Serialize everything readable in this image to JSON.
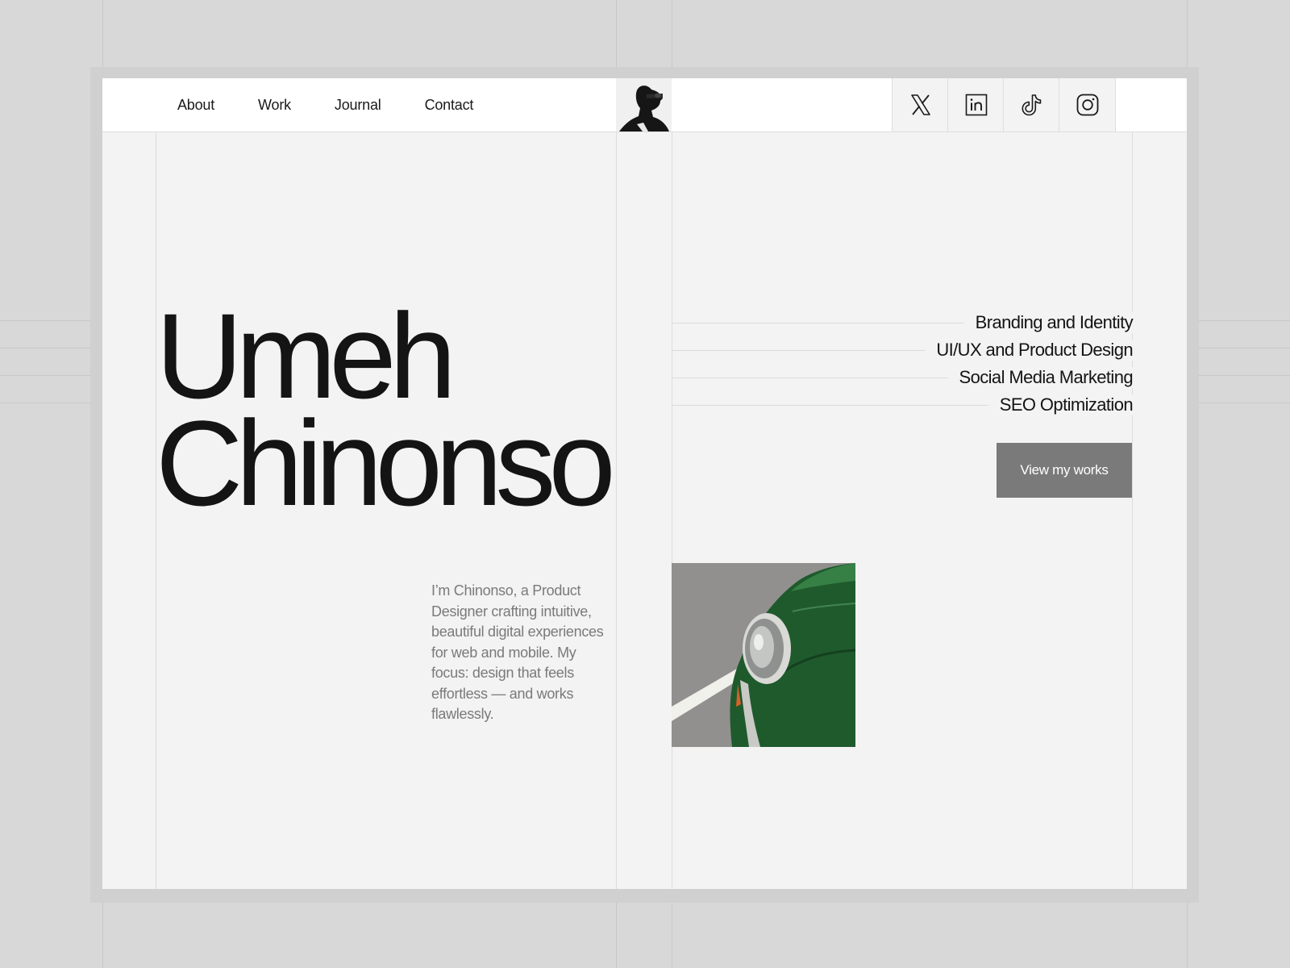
{
  "nav": {
    "items": [
      {
        "label": "About"
      },
      {
        "label": "Work"
      },
      {
        "label": "Journal"
      },
      {
        "label": "Contact"
      }
    ]
  },
  "profile": {
    "avatar_icon": "portrait-photo"
  },
  "social": [
    {
      "icon": "x-twitter-icon"
    },
    {
      "icon": "linkedin-icon"
    },
    {
      "icon": "tiktok-icon"
    },
    {
      "icon": "instagram-icon"
    }
  ],
  "hero": {
    "first_name": "Umeh",
    "last_name": "Chinonso",
    "bio": "I’m Chinonso, a Product Designer crafting intuitive, beautiful digital experiences for web and mobile. My focus: design that feels effortless — and works flawlessly."
  },
  "services": [
    {
      "label": "Branding and Identity"
    },
    {
      "label": "UI/UX and Product Design"
    },
    {
      "label": "Social Media Marketing"
    },
    {
      "label": "SEO Optimization"
    }
  ],
  "cta": {
    "label": "View my works"
  },
  "colors": {
    "outer_bg": "#d8d8d8",
    "page_bg": "#f3f3f3",
    "text": "#141414",
    "muted_text": "#7a7a7a",
    "button_bg": "#7a7a7a",
    "car_green": "#1f5a2c"
  }
}
